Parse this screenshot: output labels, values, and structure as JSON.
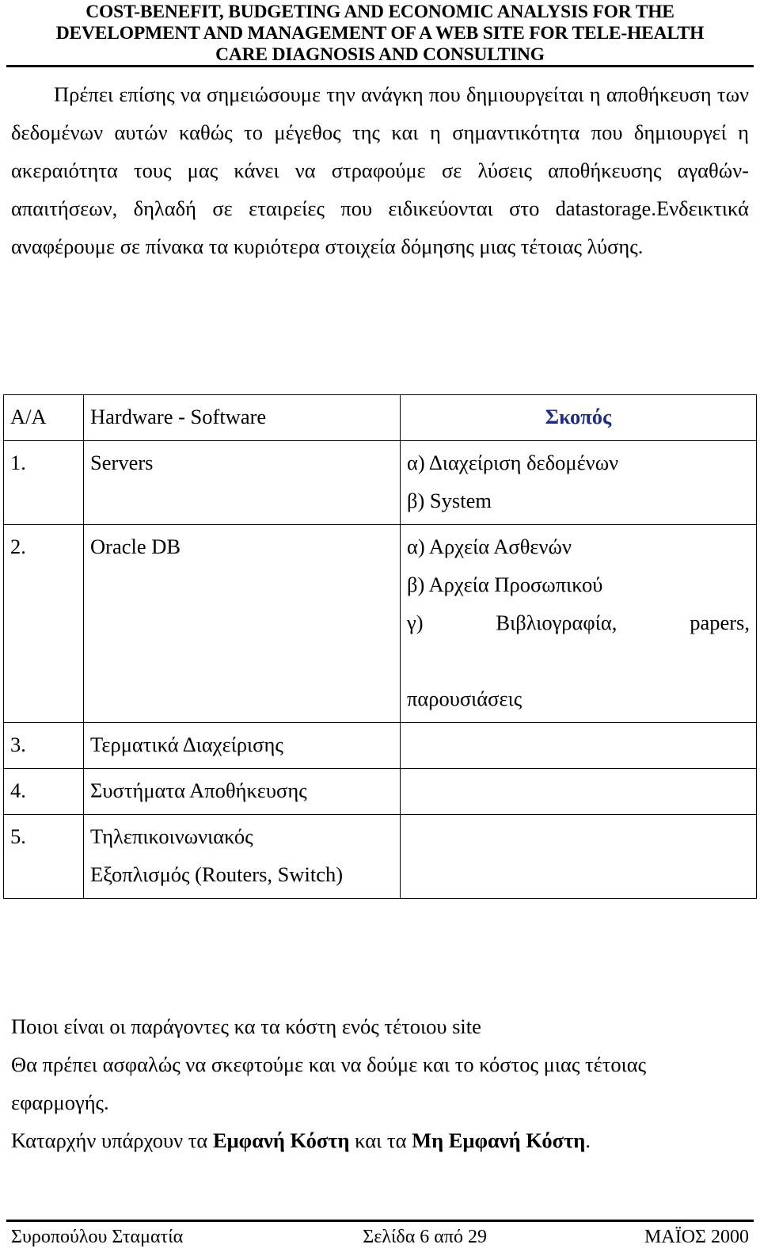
{
  "header": {
    "lines": [
      "COST-BENEFIT, BUDGETING AND ECONOMIC ANALYSIS FOR THE",
      "DEVELOPMENT AND MANAGEMENT OF A WEB SITE FOR TELE-HEALTH",
      "CARE DIAGNOSIS AND CONSULTING"
    ]
  },
  "body": {
    "intro_paragraph": "Πρέπει επίσης να σημειώσουμε την ανάγκη που δημιουργείται η αποθήκευση των δεδομένων αυτών καθώς το μέγεθος της και η σημαντικότητα που δημιουργεί η ακεραιότητα τους μας κάνει να στραφούμε σε λύσεις αποθήκευσης αγαθών-απαιτήσεων, δηλαδή σε εταιρείες που ειδικεύονται στο datastorage.Ενδεικτικά αναφέρουμε σε πίνακα τα κυριότερα στοιχεία δόμησης μιας τέτοιας λύσης."
  },
  "table": {
    "accent_color": "#1f2d80",
    "headers": {
      "aa": "A/A",
      "hardware_software": "Hardware - Software",
      "skopos": "Σκοπός"
    },
    "rows": [
      {
        "aa": "1.",
        "hardware_software": [
          "Servers"
        ],
        "skopos": [
          "α) Διαχείριση δεδομένων",
          "β) System"
        ]
      },
      {
        "aa": "2.",
        "hardware_software": [
          "Oracle DB"
        ],
        "skopos": [
          "α) Αρχεία Ασθενών",
          "β) Αρχεία Προσωπικού",
          "γ) Βιβλιογραφία, papers,",
          "παρουσιάσεις"
        ]
      },
      {
        "aa": "3.",
        "hardware_software": [
          "Τερματικά Διαχείρισης"
        ],
        "skopos": []
      },
      {
        "aa": "4.",
        "hardware_software": [
          "Συστήματα Αποθήκευσης"
        ],
        "skopos": []
      },
      {
        "aa": "5.",
        "hardware_software": [
          "Τηλεπικοινωνιακός",
          "Εξοπλισμός (Routers, Switch)"
        ],
        "skopos": []
      }
    ]
  },
  "lower": {
    "line1": "Ποιοι είναι οι παράγοντες κα τα κόστη ενός τέτοιου site",
    "line2": "Θα πρέπει ασφαλώς να σκεφτούμε και να δούμε και το κόστος μιας τέτοιας εφαρμογής.",
    "line3_a": "Καταρχήν υπάρχουν τα ",
    "line3_b": "Εμφανή Κόστη",
    "line3_c": " και τα ",
    "line3_d": "Μη Εμφανή Κόστη",
    "line3_e": "."
  },
  "footer": {
    "author": "Συροπούλου Σταματία",
    "page": "Σελίδα 6 από 29",
    "date": "ΜΑΪΟΣ 2000"
  }
}
